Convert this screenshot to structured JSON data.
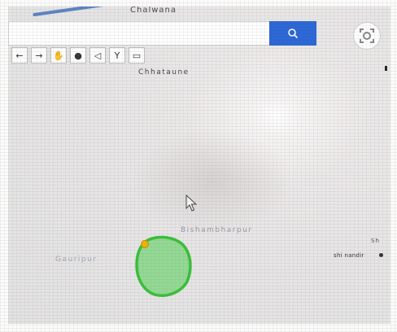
{
  "search": {
    "value": "",
    "placeholder": ""
  },
  "toolbar": {
    "tools": [
      {
        "glyph": "←"
      },
      {
        "glyph": "→"
      },
      {
        "glyph": "✋"
      },
      {
        "glyph": "●"
      },
      {
        "glyph": "◁"
      },
      {
        "glyph": "Y"
      },
      {
        "glyph": "▭"
      }
    ]
  },
  "map": {
    "labels": {
      "top": "Chalwana",
      "chhataune": "Chhataune",
      "mid": "Bishambharpur",
      "left": "Gauripur",
      "right_top": "Sh",
      "right": "shi nandir"
    },
    "boundary_color": "#2fbf2f",
    "fill_color": "#8fd98f",
    "marker_color": "#f0b400",
    "accent_color": "#2a66d6"
  },
  "icons": {
    "search": "search-icon",
    "locate": "locate-icon",
    "cursor": "cursor-icon"
  }
}
